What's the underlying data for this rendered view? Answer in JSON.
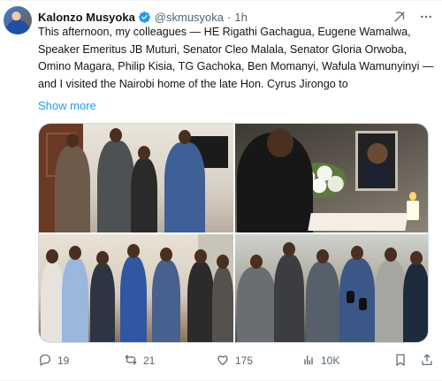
{
  "author": {
    "display_name": "Kalonzo Musyoka",
    "handle": "@skmusyoka",
    "separator": "·",
    "time": "1h"
  },
  "tweet": {
    "text": "This afternoon, my colleagues — HE Rigathi Gachagua, Eugene Wamalwa, Speaker Emeritus JB Muturi, Senator Cleo Malala, Senator Gloria Orwoba, Omino Magara, Philip Kisia, TG Gachoka, Ben Momanyi, Wafula Wamunyinyi — and I visited the Nairobi home of the late Hon. Cyrus Jirongo to",
    "show_more": "Show more"
  },
  "icons": {
    "verified": "verified-badge-icon",
    "grok": "grok-icon",
    "more": "more-icon",
    "reply": "reply-icon",
    "repost": "repost-icon",
    "like": "heart-icon",
    "views": "views-icon",
    "bookmark": "bookmark-icon",
    "share": "share-icon"
  },
  "stats": {
    "replies": "19",
    "reposts": "21",
    "likes": "175",
    "views": "10K"
  },
  "colors": {
    "accent": "#1d9bf0",
    "text": "#0f1419",
    "secondary": "#536471",
    "border": "#cfd9de"
  }
}
